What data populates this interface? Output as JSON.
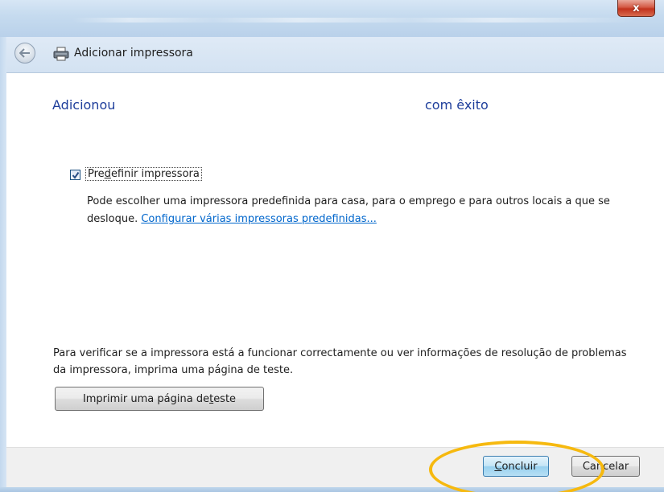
{
  "window": {
    "close_label": "x"
  },
  "header": {
    "title": "Adicionar impressora"
  },
  "main": {
    "heading_left": "Adicionou",
    "heading_right": "com êxito",
    "default_printer_checkbox": {
      "label_prefix": "Pre",
      "label_accel": "d",
      "label_suffix": "efinir impressora",
      "checked": true
    },
    "description_text": "Pode escolher uma impressora predefinida para casa, para o emprego e para outros locais a que se desloque.",
    "description_link": "Configurar várias impressoras predefinidas...",
    "test_info": "Para verificar se a impressora está a funcionar correctamente ou ver informações de resolução de problemas da impressora, imprima uma página de teste.",
    "test_button": {
      "prefix": "Imprimir uma página de ",
      "accel": "t",
      "suffix": "este"
    }
  },
  "footer": {
    "conclude_button": {
      "accel": "C",
      "suffix": "oncluir"
    },
    "cancel_button": {
      "prefix": "Cancelar"
    }
  },
  "colors": {
    "heading": "#1e3e9b",
    "link": "#0066cc",
    "highlight_ring": "#f6b90f"
  }
}
